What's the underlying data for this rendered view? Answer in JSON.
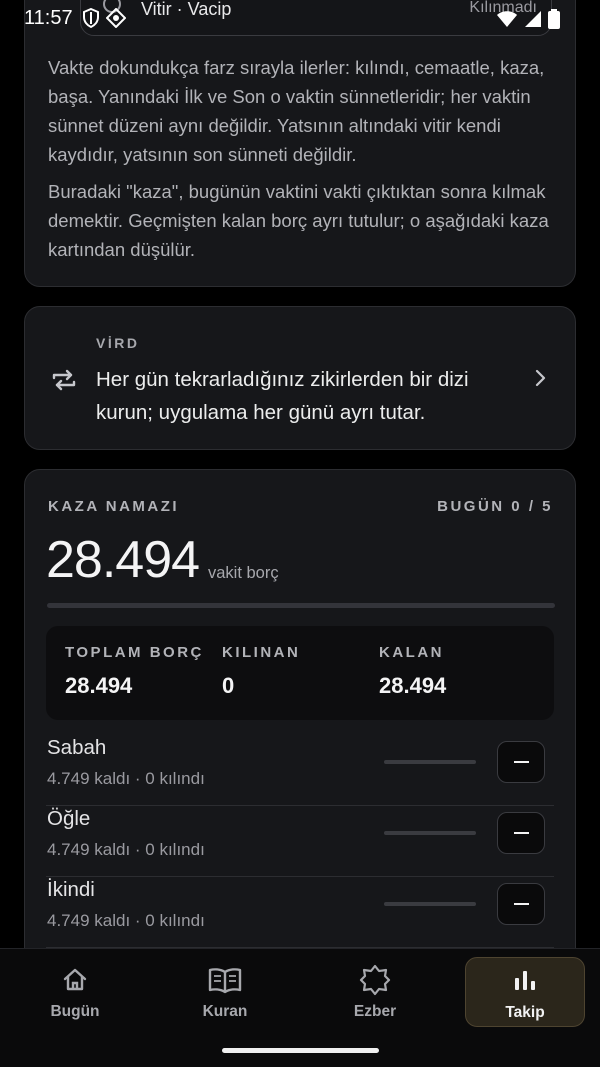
{
  "status_bar": {
    "time": "11:57"
  },
  "peek_card": {
    "title": "Vitir · Vacip",
    "status": "Kılınmadı"
  },
  "info": {
    "paragraph_1": "Vakte dokundukça farz sırayla ilerler: kılındı, cemaatle, kaza, başa. Yanındaki İlk ve Son o vaktin sünnetleridir; her vaktin sünnet düzeni aynı değildir. Yatsının altındaki vitir kendi kaydıdır, yatsının son sünneti değildir.",
    "paragraph_2": "Buradaki \"kaza\", bugünün vaktini vakti çıktıktan sonra kılmak demektir. Geçmişten kalan borç ayrı tutulur; o aşağıdaki kaza kartından düşülür."
  },
  "vird": {
    "label": "VİRD",
    "text": "Her gün tekrarladığınız zikirlerden bir dizi kurun; uygulama her günü ayrı tutar."
  },
  "kaza": {
    "label": "KAZA NAMAZI",
    "today": "BUGÜN 0 / 5",
    "today_progress": 0,
    "total": "28.494",
    "unit": "vakit borç",
    "summary": [
      {
        "label": "TOPLAM BORÇ",
        "value": "28.494"
      },
      {
        "label": "KILINAN",
        "value": "0"
      },
      {
        "label": "KALAN",
        "value": "28.494"
      }
    ],
    "prayers": [
      {
        "name": "Sabah",
        "sub": "4.749 kaldı · 0 kılındı",
        "progress": 0
      },
      {
        "name": "Öğle",
        "sub": "4.749 kaldı · 0 kılındı",
        "progress": 0
      },
      {
        "name": "İkindi",
        "sub": "4.749 kaldı · 0 kılındı",
        "progress": 0
      }
    ]
  },
  "nav": [
    {
      "label": "Bugün",
      "icon": "home-icon",
      "active": false
    },
    {
      "label": "Kuran",
      "icon": "book-icon",
      "active": false
    },
    {
      "label": "Ezber",
      "icon": "star-icon",
      "active": false
    },
    {
      "label": "Takip",
      "icon": "chart-icon",
      "active": true
    }
  ],
  "colors": {
    "accent": "#c9a255",
    "background": "#000000",
    "card": "#16171a"
  }
}
